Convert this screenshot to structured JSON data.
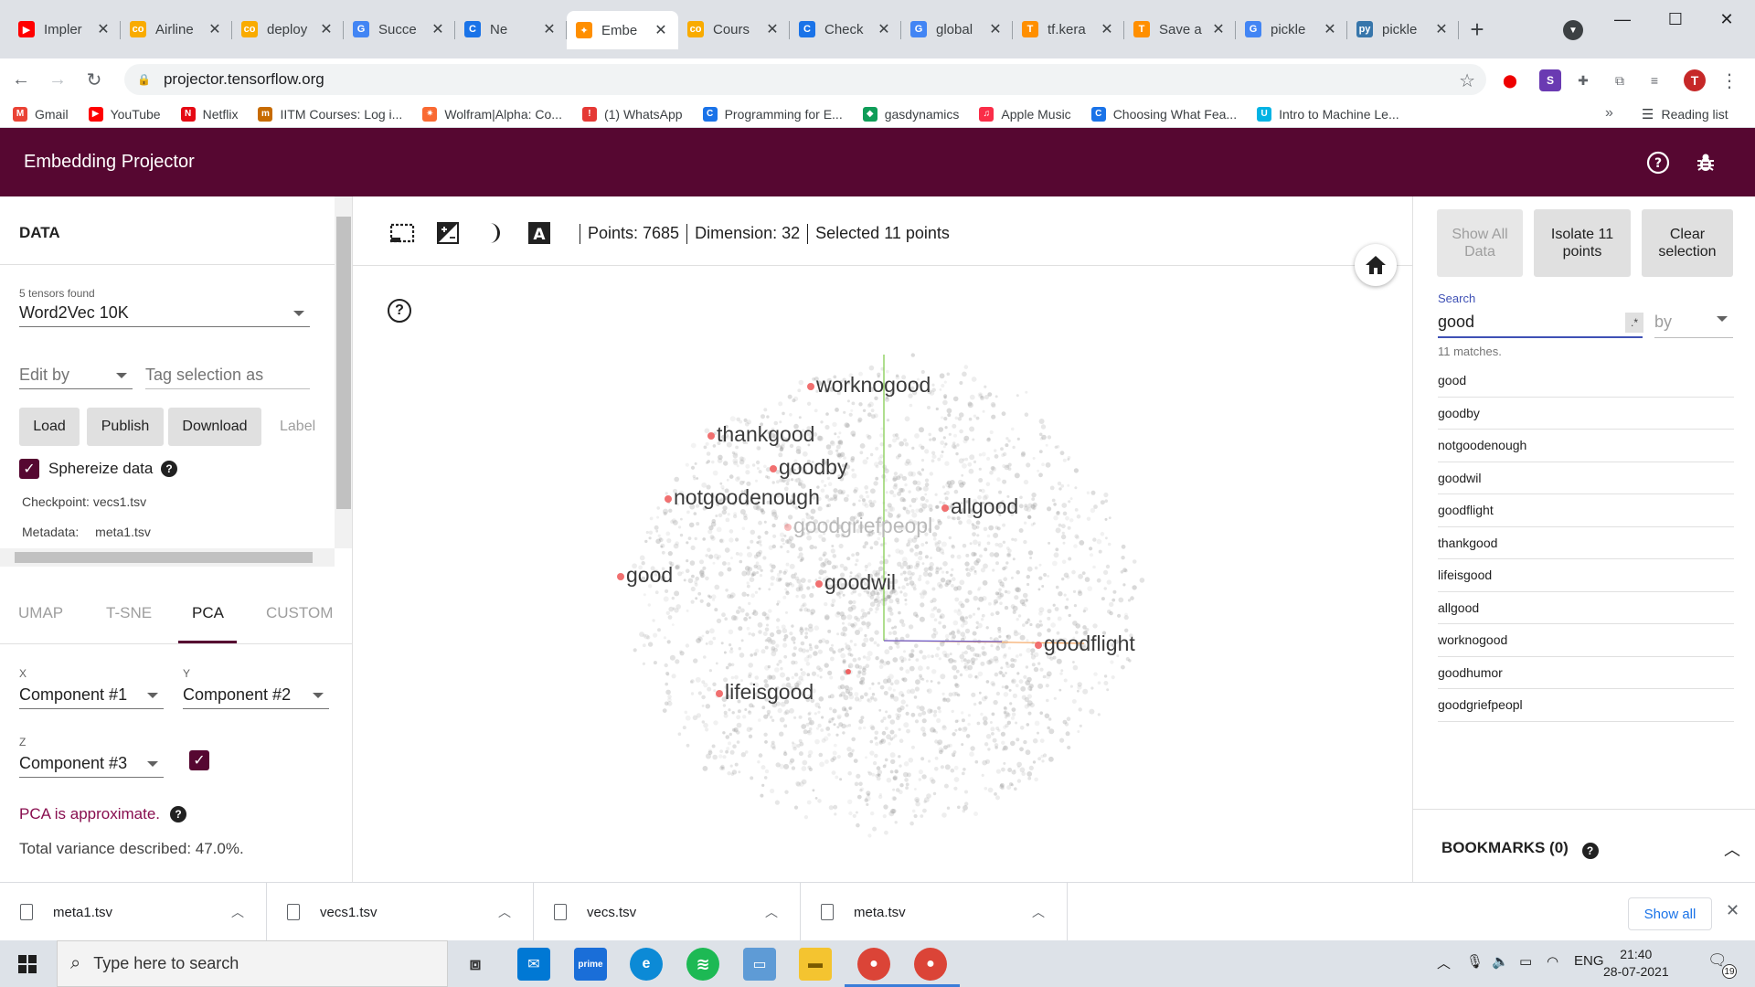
{
  "browser": {
    "tabs": [
      {
        "title": "Impler",
        "icon": "youtube-icon",
        "color": "#ff0000",
        "glyph": "▶",
        "active": false
      },
      {
        "title": "Airline",
        "icon": "colab-icon",
        "color": "#f9ab00",
        "glyph": "co",
        "active": false
      },
      {
        "title": "deploy",
        "icon": "colab-icon",
        "color": "#f9ab00",
        "glyph": "co",
        "active": false
      },
      {
        "title": "Succe",
        "icon": "google-icon",
        "color": "#4285f4",
        "glyph": "G",
        "active": false
      },
      {
        "title": "Ne",
        "icon": "coursera-icon",
        "color": "#1a73e8",
        "glyph": "C",
        "active": false
      },
      {
        "title": "Embe",
        "icon": "tensorflow-icon",
        "color": "#ff8f00",
        "glyph": "✦",
        "active": true
      },
      {
        "title": "Cours",
        "icon": "colab-icon",
        "color": "#f9ab00",
        "glyph": "co",
        "active": false
      },
      {
        "title": "Check",
        "icon": "coursera-icon",
        "color": "#1a73e8",
        "glyph": "C",
        "active": false
      },
      {
        "title": "global",
        "icon": "google-icon",
        "color": "#4285f4",
        "glyph": "G",
        "active": false
      },
      {
        "title": "tf.kera",
        "icon": "tensorflow-icon",
        "color": "#ff8f00",
        "glyph": "T",
        "active": false
      },
      {
        "title": "Save a",
        "icon": "tensorflow-icon",
        "color": "#ff8f00",
        "glyph": "T",
        "active": false
      },
      {
        "title": "pickle",
        "icon": "google-icon",
        "color": "#4285f4",
        "glyph": "G",
        "active": false
      },
      {
        "title": "pickle",
        "icon": "python-icon",
        "color": "#3776ab",
        "glyph": "py",
        "active": false
      }
    ],
    "url": "projector.tensorflow.org",
    "bookmarks": [
      {
        "label": "Gmail",
        "icon": "gmail-icon",
        "color": "#ea4335",
        "glyph": "M"
      },
      {
        "label": "YouTube",
        "icon": "youtube-icon",
        "color": "#ff0000",
        "glyph": "▶"
      },
      {
        "label": "Netflix",
        "icon": "netflix-icon",
        "color": "#e50914",
        "glyph": "N"
      },
      {
        "label": "IITM Courses: Log i...",
        "icon": "iitm-icon",
        "color": "#c76b00",
        "glyph": "m"
      },
      {
        "label": "Wolfram|Alpha: Co...",
        "icon": "wolfram-icon",
        "color": "#f96932",
        "glyph": "✷"
      },
      {
        "label": "(1) WhatsApp",
        "icon": "whatsapp-icon",
        "color": "#e53935",
        "glyph": "!"
      },
      {
        "label": "Programming for E...",
        "icon": "coursera-icon",
        "color": "#1a73e8",
        "glyph": "C"
      },
      {
        "label": "gasdynamics",
        "icon": "classroom-icon",
        "color": "#0f9d58",
        "glyph": "◆"
      },
      {
        "label": "Apple Music",
        "icon": "music-icon",
        "color": "#fa2d48",
        "glyph": "♫"
      },
      {
        "label": "Choosing What Fea...",
        "icon": "coursera-icon",
        "color": "#1a73e8",
        "glyph": "C"
      },
      {
        "label": "Intro to Machine Le...",
        "icon": "udacity-icon",
        "color": "#02b3e4",
        "glyph": "U"
      }
    ],
    "more_bookmarks": "»",
    "reading_list": "Reading list",
    "profile_initial": "T"
  },
  "app": {
    "title": "Embedding Projector"
  },
  "data_panel": {
    "heading": "DATA",
    "tensors_found": "5 tensors found",
    "tensor": "Word2Vec 10K",
    "edit_by": "Edit by",
    "tag_placeholder": "Tag selection as",
    "load": "Load",
    "publish": "Publish",
    "download": "Download",
    "label": "Label",
    "sphereize": "Sphereize data",
    "checkpoint": "Checkpoint: vecs1.tsv",
    "metadata_label": "Metadata:",
    "metadata_value": "meta1.tsv"
  },
  "projection": {
    "tabs": [
      "UMAP",
      "T-SNE",
      "PCA",
      "CUSTOM"
    ],
    "active_tab": "PCA",
    "x_label": "X",
    "x_value": "Component #1",
    "y_label": "Y",
    "y_value": "Component #2",
    "z_label": "Z",
    "z_value": "Component #3",
    "approx": "PCA is approximate.",
    "variance": "Total variance described: 47.0%."
  },
  "canvas": {
    "points": "Points: 7685",
    "dimension": "Dimension: 32",
    "selected": "Selected 11 points",
    "labels": [
      {
        "text": "worknogood",
        "faint": false
      },
      {
        "text": "thankgood",
        "faint": false
      },
      {
        "text": "goodby",
        "faint": false
      },
      {
        "text": "notgoodenough",
        "faint": false
      },
      {
        "text": "allgood",
        "faint": false
      },
      {
        "text": "goodgriefpeopl",
        "faint": true
      },
      {
        "text": "good",
        "faint": false
      },
      {
        "text": "goodwil",
        "faint": false
      },
      {
        "text": "goodflight",
        "faint": false
      },
      {
        "text": "lifeisgood",
        "faint": false
      }
    ],
    "highlight_color": "#f06060",
    "point_color": "#9e9e9e"
  },
  "inspector": {
    "show_all": "Show All Data",
    "isolate": "Isolate 11 points",
    "clear": "Clear selection",
    "search_label": "Search",
    "search_value": "good",
    "regex": ".*",
    "by": "by",
    "matches": "11 matches.",
    "results": [
      "good",
      "goodby",
      "notgoodenough",
      "goodwil",
      "goodflight",
      "thankgood",
      "lifeisgood",
      "allgood",
      "worknogood",
      "goodhumor",
      "goodgriefpeopl"
    ],
    "bookmarks": "BOOKMARKS (0)"
  },
  "downloads": {
    "files": [
      "meta1.tsv",
      "vecs1.tsv",
      "vecs.tsv",
      "meta.tsv"
    ],
    "show_all": "Show all"
  },
  "taskbar": {
    "search_placeholder": "Type here to search",
    "lang": "ENG",
    "time": "21:40",
    "date": "28-07-2021",
    "notifications": "19"
  }
}
